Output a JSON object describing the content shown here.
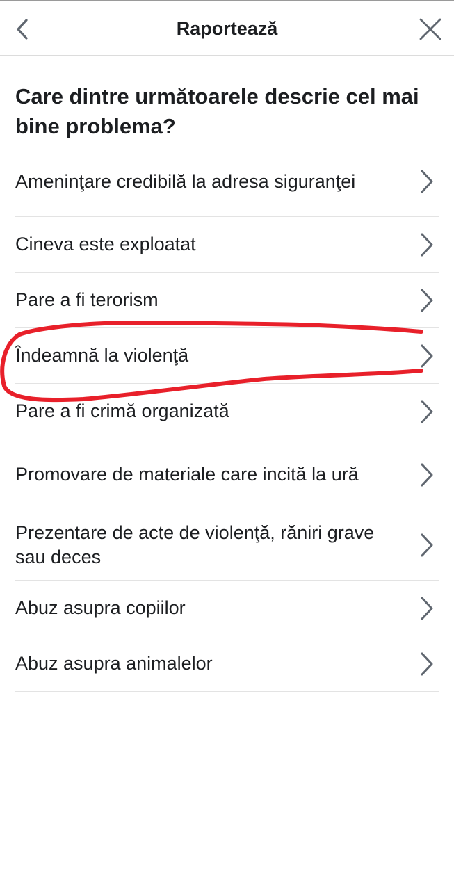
{
  "header": {
    "title": "Raportează",
    "back_icon": "chevron-left-icon",
    "close_icon": "close-icon"
  },
  "question": "Care dintre următoarele descrie cel mai bine problema?",
  "options": [
    {
      "label": "Ameninţare credibilă la adresa siguranţei"
    },
    {
      "label": "Cineva este exploatat"
    },
    {
      "label": "Pare a fi terorism"
    },
    {
      "label": "Îndeamnă la violenţă"
    },
    {
      "label": "Pare a fi crimă organizată"
    },
    {
      "label": "Promovare de materiale care incită la ură"
    },
    {
      "label": "Prezentare de acte de violenţă, răniri grave sau deces"
    },
    {
      "label": "Abuz asupra copiilor"
    },
    {
      "label": "Abuz asupra animalelor"
    }
  ],
  "colors": {
    "text": "#1c1e21",
    "chevron": "#606770",
    "divider": "#e3e3e3",
    "annotation": "#e8202a"
  }
}
